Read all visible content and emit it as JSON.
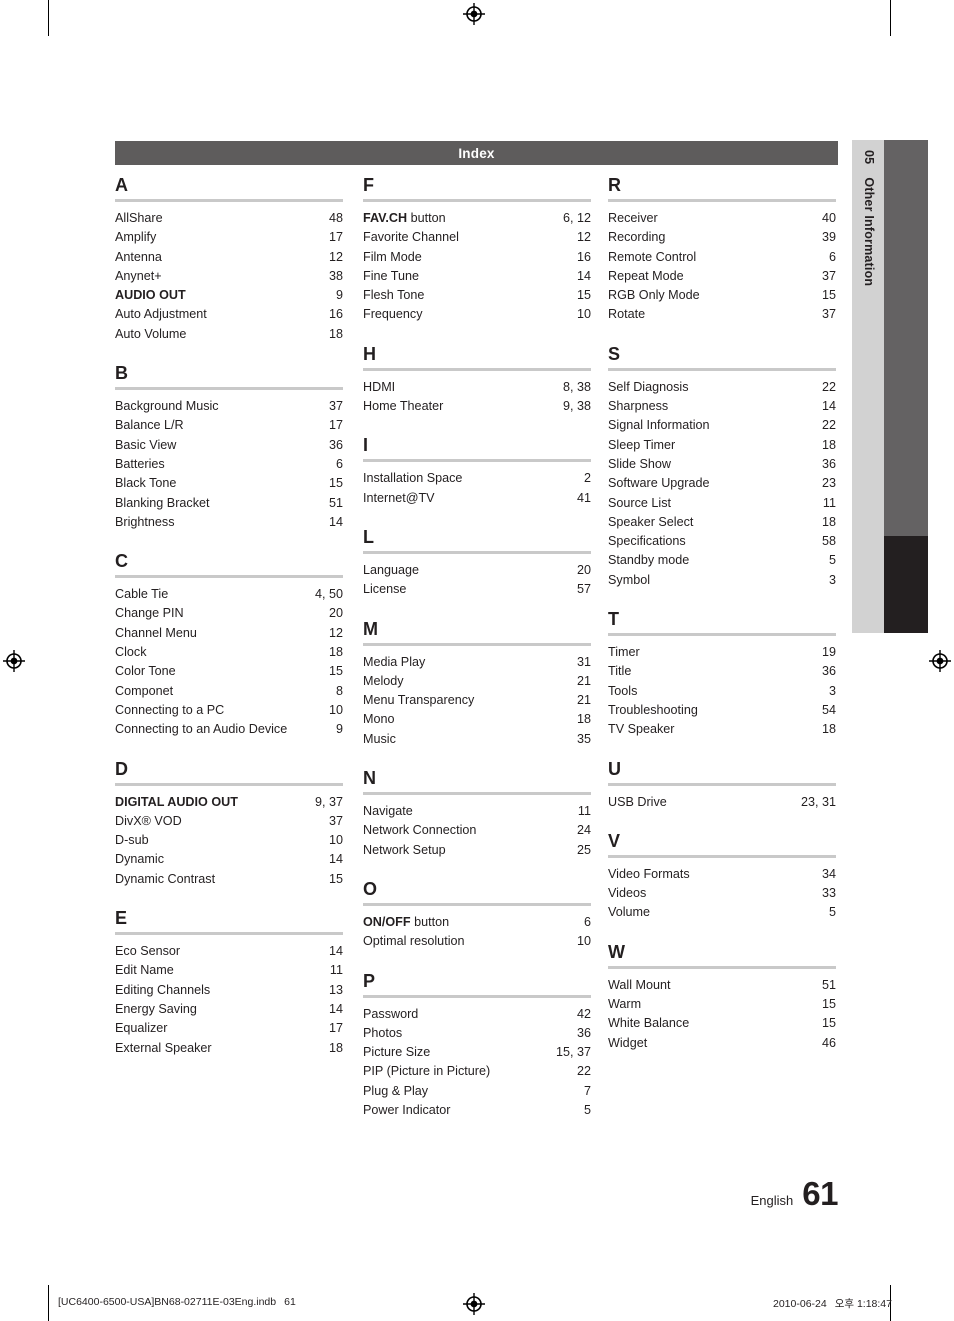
{
  "header": {
    "title": "Index"
  },
  "side_tab": {
    "number": "05",
    "label": "Other Information"
  },
  "footer": {
    "language": "English",
    "page_number": "61"
  },
  "print_meta": {
    "file": "[UC6400-6500-USA]BN68-02711E-03Eng.indb",
    "page": "61",
    "date": "2010-06-24",
    "time": "오후 1:18:47"
  },
  "columns": [
    {
      "groups": [
        {
          "letter": "A",
          "entries": [
            {
              "label": "AllShare",
              "bold": false,
              "page": "48"
            },
            {
              "label": "Amplify",
              "bold": false,
              "page": "17"
            },
            {
              "label": "Antenna",
              "bold": false,
              "page": "12"
            },
            {
              "label": "Anynet+",
              "bold": false,
              "page": "38"
            },
            {
              "label": "AUDIO OUT",
              "bold": true,
              "page": "9"
            },
            {
              "label": "Auto Adjustment",
              "bold": false,
              "page": "16"
            },
            {
              "label": "Auto Volume",
              "bold": false,
              "page": "18"
            }
          ]
        },
        {
          "letter": "B",
          "entries": [
            {
              "label": "Background Music",
              "bold": false,
              "page": "37"
            },
            {
              "label": "Balance L/R",
              "bold": false,
              "page": "17"
            },
            {
              "label": "Basic View",
              "bold": false,
              "page": "36"
            },
            {
              "label": "Batteries",
              "bold": false,
              "page": "6"
            },
            {
              "label": "Black Tone",
              "bold": false,
              "page": "15"
            },
            {
              "label": "Blanking Bracket",
              "bold": false,
              "page": "51"
            },
            {
              "label": "Brightness",
              "bold": false,
              "page": "14"
            }
          ]
        },
        {
          "letter": "C",
          "entries": [
            {
              "label": "Cable Tie",
              "bold": false,
              "page": "4, 50"
            },
            {
              "label": "Change PIN",
              "bold": false,
              "page": "20"
            },
            {
              "label": "Channel Menu",
              "bold": false,
              "page": "12"
            },
            {
              "label": "Clock",
              "bold": false,
              "page": "18"
            },
            {
              "label": "Color Tone",
              "bold": false,
              "page": "15"
            },
            {
              "label": "Componet",
              "bold": false,
              "page": "8"
            },
            {
              "label": "Connecting to a PC",
              "bold": false,
              "page": "10"
            },
            {
              "label": "Connecting to an Audio Device",
              "bold": false,
              "page": "9"
            }
          ]
        },
        {
          "letter": "D",
          "entries": [
            {
              "label": "DIGITAL AUDIO OUT",
              "bold": true,
              "page": "9, 37"
            },
            {
              "label": "DivX® VOD",
              "bold": false,
              "page": "37"
            },
            {
              "label": "D-sub",
              "bold": false,
              "page": "10"
            },
            {
              "label": "Dynamic",
              "bold": false,
              "page": "14"
            },
            {
              "label": "Dynamic Contrast",
              "bold": false,
              "page": "15"
            }
          ]
        },
        {
          "letter": "E",
          "entries": [
            {
              "label": "Eco Sensor",
              "bold": false,
              "page": "14"
            },
            {
              "label": "Edit Name",
              "bold": false,
              "page": "11"
            },
            {
              "label": "Editing Channels",
              "bold": false,
              "page": "13"
            },
            {
              "label": "Energy Saving",
              "bold": false,
              "page": "14"
            },
            {
              "label": "Equalizer",
              "bold": false,
              "page": "17"
            },
            {
              "label": "External Speaker",
              "bold": false,
              "page": "18"
            }
          ]
        }
      ]
    },
    {
      "groups": [
        {
          "letter": "F",
          "entries": [
            {
              "label": "FAV.CH",
              "label_rest": " button",
              "bold": true,
              "page": "6, 12"
            },
            {
              "label": "Favorite Channel",
              "bold": false,
              "page": "12"
            },
            {
              "label": "Film Mode",
              "bold": false,
              "page": "16"
            },
            {
              "label": "Fine Tune",
              "bold": false,
              "page": "14"
            },
            {
              "label": "Flesh Tone",
              "bold": false,
              "page": "15"
            },
            {
              "label": "Frequency",
              "bold": false,
              "page": "10"
            }
          ]
        },
        {
          "letter": "H",
          "entries": [
            {
              "label": "HDMI",
              "bold": false,
              "page": "8, 38"
            },
            {
              "label": "Home Theater",
              "bold": false,
              "page": "9, 38"
            }
          ]
        },
        {
          "letter": "I",
          "entries": [
            {
              "label": "Installation Space",
              "bold": false,
              "page": "2"
            },
            {
              "label": "Internet@TV",
              "bold": false,
              "page": "41"
            }
          ]
        },
        {
          "letter": "L",
          "entries": [
            {
              "label": "Language",
              "bold": false,
              "page": "20"
            },
            {
              "label": "License",
              "bold": false,
              "page": "57"
            }
          ]
        },
        {
          "letter": "M",
          "entries": [
            {
              "label": "Media Play",
              "bold": false,
              "page": "31"
            },
            {
              "label": "Melody",
              "bold": false,
              "page": "21"
            },
            {
              "label": "Menu Transparency",
              "bold": false,
              "page": "21"
            },
            {
              "label": "Mono",
              "bold": false,
              "page": "18"
            },
            {
              "label": "Music",
              "bold": false,
              "page": "35"
            }
          ]
        },
        {
          "letter": "N",
          "entries": [
            {
              "label": "Navigate",
              "bold": false,
              "page": "11"
            },
            {
              "label": "Network Connection",
              "bold": false,
              "page": "24"
            },
            {
              "label": "Network Setup",
              "bold": false,
              "page": "25"
            }
          ]
        },
        {
          "letter": "O",
          "entries": [
            {
              "label": "ON/OFF",
              "label_rest": " button",
              "bold": true,
              "page": "6"
            },
            {
              "label": "Optimal resolution",
              "bold": false,
              "page": "10"
            }
          ]
        },
        {
          "letter": "P",
          "entries": [
            {
              "label": "Password",
              "bold": false,
              "page": "42"
            },
            {
              "label": "Photos",
              "bold": false,
              "page": "36"
            },
            {
              "label": "Picture Size",
              "bold": false,
              "page": "15, 37"
            },
            {
              "label": "PIP (Picture in Picture)",
              "bold": false,
              "page": "22"
            },
            {
              "label": "Plug & Play",
              "bold": false,
              "page": "7"
            },
            {
              "label": "Power Indicator",
              "bold": false,
              "page": "5"
            }
          ]
        }
      ]
    },
    {
      "groups": [
        {
          "letter": "R",
          "entries": [
            {
              "label": "Receiver",
              "bold": false,
              "page": "40"
            },
            {
              "label": "Recording",
              "bold": false,
              "page": "39"
            },
            {
              "label": "Remote Control",
              "bold": false,
              "page": "6"
            },
            {
              "label": "Repeat Mode",
              "bold": false,
              "page": "37"
            },
            {
              "label": "RGB Only Mode",
              "bold": false,
              "page": "15"
            },
            {
              "label": "Rotate",
              "bold": false,
              "page": "37"
            }
          ]
        },
        {
          "letter": "S",
          "entries": [
            {
              "label": "Self Diagnosis",
              "bold": false,
              "page": "22"
            },
            {
              "label": "Sharpness",
              "bold": false,
              "page": "14"
            },
            {
              "label": "Signal Information",
              "bold": false,
              "page": "22"
            },
            {
              "label": "Sleep Timer",
              "bold": false,
              "page": "18"
            },
            {
              "label": "Slide Show",
              "bold": false,
              "page": "36"
            },
            {
              "label": "Software Upgrade",
              "bold": false,
              "page": "23"
            },
            {
              "label": "Source List",
              "bold": false,
              "page": "11"
            },
            {
              "label": "Speaker Select",
              "bold": false,
              "page": "18"
            },
            {
              "label": "Specifications",
              "bold": false,
              "page": "58"
            },
            {
              "label": "Standby mode",
              "bold": false,
              "page": "5"
            },
            {
              "label": "Symbol",
              "bold": false,
              "page": "3"
            }
          ]
        },
        {
          "letter": "T",
          "entries": [
            {
              "label": "Timer",
              "bold": false,
              "page": "19"
            },
            {
              "label": "Title",
              "bold": false,
              "page": "36"
            },
            {
              "label": "Tools",
              "bold": false,
              "page": "3"
            },
            {
              "label": "Troubleshooting",
              "bold": false,
              "page": "54"
            },
            {
              "label": "TV Speaker",
              "bold": false,
              "page": "18"
            }
          ]
        },
        {
          "letter": "U",
          "entries": [
            {
              "label": "USB Drive",
              "bold": false,
              "page": "23, 31"
            }
          ]
        },
        {
          "letter": "V",
          "entries": [
            {
              "label": "Video Formats",
              "bold": false,
              "page": "34"
            },
            {
              "label": "Videos",
              "bold": false,
              "page": "33"
            },
            {
              "label": "Volume",
              "bold": false,
              "page": "5"
            }
          ]
        },
        {
          "letter": "W",
          "entries": [
            {
              "label": "Wall Mount",
              "bold": false,
              "page": "51"
            },
            {
              "label": "Warm",
              "bold": false,
              "page": "15"
            },
            {
              "label": "White Balance",
              "bold": false,
              "page": "15"
            },
            {
              "label": "Widget",
              "bold": false,
              "page": "46"
            }
          ]
        }
      ]
    }
  ]
}
